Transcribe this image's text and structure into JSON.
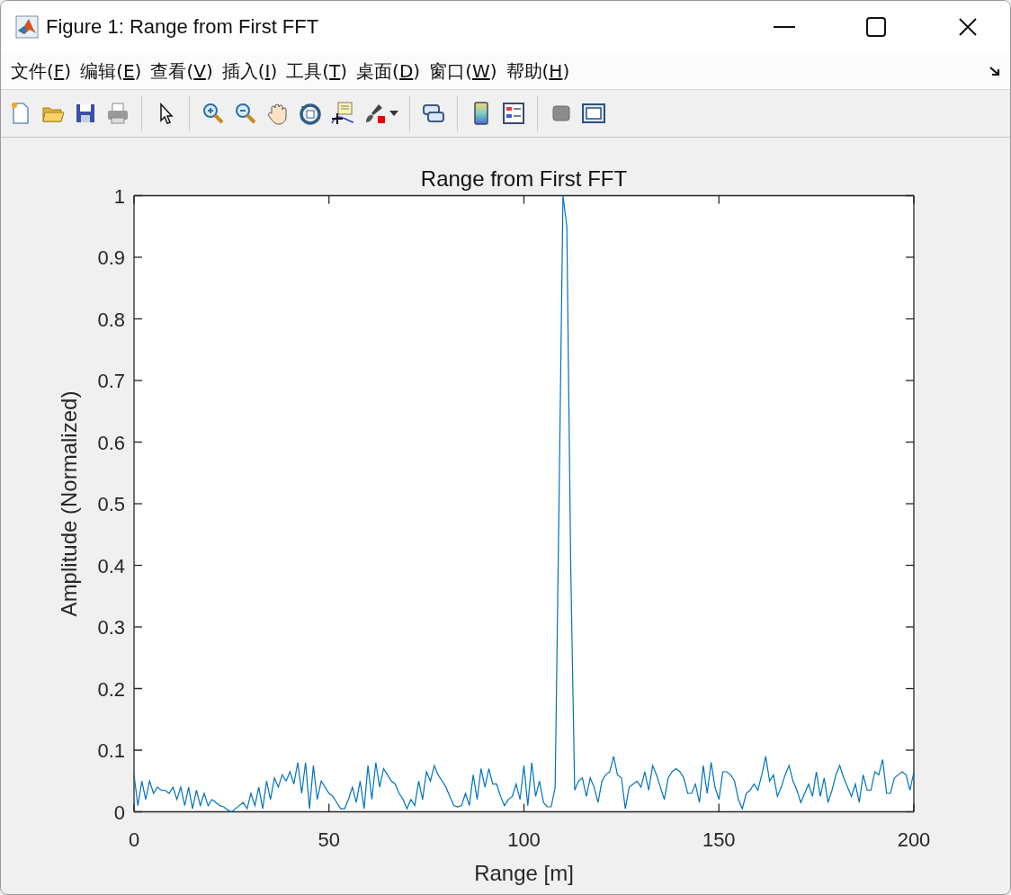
{
  "window": {
    "title": "Figure 1: Range from First FFT"
  },
  "menu": [
    {
      "label": "文件(F)"
    },
    {
      "label": "编辑(E)"
    },
    {
      "label": "查看(V)"
    },
    {
      "label": "插入(I)"
    },
    {
      "label": "工具(T)"
    },
    {
      "label": "桌面(D)"
    },
    {
      "label": "窗口(W)"
    },
    {
      "label": "帮助(H)"
    }
  ],
  "chart_data": {
    "type": "line",
    "title": "Range from First FFT",
    "xlabel": "Range [m]",
    "ylabel": "Amplitude (Normalized)",
    "xlim": [
      0,
      200
    ],
    "ylim": [
      0,
      1
    ],
    "xticks": [
      0,
      50,
      100,
      150,
      200
    ],
    "yticks": [
      0,
      0.1,
      0.2,
      0.3,
      0.4,
      0.5,
      0.6,
      0.7,
      0.8,
      0.9,
      1
    ],
    "x": [
      0,
      1,
      2,
      3,
      4,
      5,
      6,
      7,
      8,
      9,
      10,
      11,
      12,
      13,
      14,
      15,
      16,
      17,
      18,
      19,
      20,
      21,
      22,
      23,
      24,
      25,
      26,
      27,
      28,
      29,
      30,
      31,
      32,
      33,
      34,
      35,
      36,
      37,
      38,
      39,
      40,
      41,
      42,
      43,
      44,
      45,
      46,
      47,
      48,
      49,
      50,
      51,
      52,
      53,
      54,
      55,
      56,
      57,
      58,
      59,
      60,
      61,
      62,
      63,
      64,
      65,
      66,
      67,
      68,
      69,
      70,
      71,
      72,
      73,
      74,
      75,
      76,
      77,
      78,
      79,
      80,
      81,
      82,
      83,
      84,
      85,
      86,
      87,
      88,
      89,
      90,
      91,
      92,
      93,
      94,
      95,
      96,
      97,
      98,
      99,
      100,
      101,
      102,
      103,
      104,
      105,
      106,
      107,
      108,
      109,
      110,
      111,
      112,
      113,
      114,
      115,
      116,
      117,
      118,
      119,
      120,
      121,
      122,
      123,
      124,
      125,
      126,
      127,
      128,
      129,
      130,
      131,
      132,
      133,
      134,
      135,
      136,
      137,
      138,
      139,
      140,
      141,
      142,
      143,
      144,
      145,
      146,
      147,
      148,
      149,
      150,
      151,
      152,
      153,
      154,
      155,
      156,
      157,
      158,
      159,
      160,
      161,
      162,
      163,
      164,
      165,
      166,
      167,
      168,
      169,
      170,
      171,
      172,
      173,
      174,
      175,
      176,
      177,
      178,
      179,
      180,
      181,
      182,
      183,
      184,
      185,
      186,
      187,
      188,
      189,
      190,
      191,
      192,
      193,
      194,
      195,
      196,
      197,
      198,
      199,
      200
    ],
    "series": [
      {
        "color": "#0072bd",
        "values": [
          0.06,
          0.01,
          0.05,
          0.02,
          0.05,
          0.03,
          0.04,
          0.035,
          0.035,
          0.03,
          0.04,
          0.02,
          0.04,
          0.01,
          0.04,
          0.005,
          0.035,
          0.01,
          0.03,
          0.01,
          0.02,
          0.015,
          0.01,
          0.008,
          0.003,
          0,
          0.005,
          0.01,
          0.015,
          0.005,
          0.03,
          0.01,
          0.04,
          0.005,
          0.05,
          0.02,
          0.055,
          0.04,
          0.06,
          0.05,
          0.065,
          0.045,
          0.08,
          0.03,
          0.08,
          0.005,
          0.075,
          0.02,
          0.05,
          0.04,
          0.03,
          0.025,
          0.015,
          0.005,
          0.005,
          0.02,
          0.04,
          0.015,
          0.05,
          0.005,
          0.075,
          0.02,
          0.08,
          0.04,
          0.07,
          0.06,
          0.05,
          0.045,
          0.03,
          0.02,
          0.005,
          0.02,
          0.01,
          0.05,
          0.02,
          0.065,
          0.05,
          0.075,
          0.06,
          0.05,
          0.04,
          0.025,
          0.01,
          0.008,
          0.01,
          0.03,
          0.01,
          0.06,
          0.02,
          0.07,
          0.04,
          0.07,
          0.045,
          0.045,
          0.025,
          0.01,
          0.02,
          0.025,
          0.045,
          0.02,
          0.075,
          0.01,
          0.08,
          0.025,
          0.05,
          0.015,
          0.008,
          0.008,
          0.04,
          0.5,
          1,
          0.95,
          0.4,
          0.035,
          0.05,
          0.055,
          0.025,
          0.055,
          0.04,
          0.015,
          0.05,
          0.06,
          0.065,
          0.09,
          0.06,
          0.055,
          0.005,
          0.04,
          0.045,
          0.05,
          0.04,
          0.065,
          0.035,
          0.075,
          0.06,
          0.04,
          0.02,
          0.055,
          0.065,
          0.07,
          0.065,
          0.055,
          0.03,
          0.03,
          0.045,
          0.015,
          0.075,
          0.03,
          0.08,
          0.04,
          0.02,
          0.065,
          0.065,
          0.06,
          0.05,
          0.02,
          0.005,
          0.03,
          0.035,
          0.045,
          0.035,
          0.06,
          0.09,
          0.05,
          0.06,
          0.025,
          0.04,
          0.06,
          0.075,
          0.05,
          0.035,
          0.015,
          0.03,
          0.045,
          0.025,
          0.065,
          0.025,
          0.055,
          0.015,
          0.035,
          0.06,
          0.075,
          0.055,
          0.04,
          0.025,
          0.045,
          0.015,
          0.06,
          0.035,
          0.035,
          0.065,
          0.06,
          0.085,
          0.03,
          0.03,
          0.055,
          0.06,
          0.065,
          0.06,
          0.035,
          0.065
        ]
      }
    ]
  }
}
